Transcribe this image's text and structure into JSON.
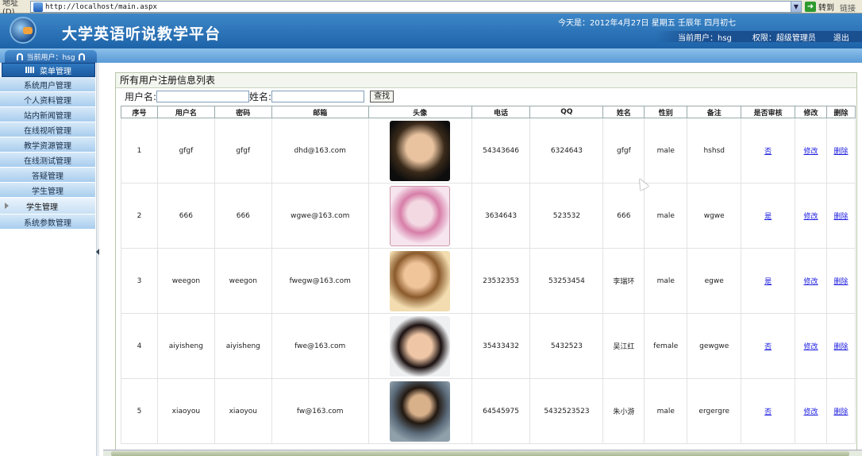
{
  "browser": {
    "address_label": "地址(D)",
    "url": "http://localhost/main.aspx",
    "go_label": "转到",
    "links_label": "链接"
  },
  "header": {
    "site_title": "大学英语听说教学平台",
    "date_text": "今天是：2012年4月27日 星期五  壬辰年  四月初七",
    "current_user_text": "当前用户：hsg",
    "permission_text": "权限：超级管理员",
    "logout_label": "退出"
  },
  "sidebar": {
    "current_user": "当前用户：hsg",
    "menu_title": "菜单管理",
    "items": [
      {
        "label": "系统用户管理"
      },
      {
        "label": "个人资料管理"
      },
      {
        "label": "站内新闻管理"
      },
      {
        "label": "在线视听管理"
      },
      {
        "label": "教学资源管理"
      },
      {
        "label": "在线测试管理"
      },
      {
        "label": "答疑管理"
      },
      {
        "label": "学生管理"
      },
      {
        "label": "学生管理"
      },
      {
        "label": "系统参数管理"
      }
    ]
  },
  "main": {
    "panel_title": "所有用户注册信息列表",
    "search": {
      "username_label": "用户名:",
      "username_value": "",
      "name_label": "姓名:",
      "name_value": "",
      "button_label": "查找"
    },
    "table": {
      "headers": [
        "序号",
        "用户名",
        "密码",
        "邮箱",
        "头像",
        "电话",
        "QQ",
        "姓名",
        "性别",
        "备注",
        "是否审核",
        "修改",
        "删除"
      ],
      "rows": [
        {
          "no": "1",
          "username": "gfgf",
          "password": "gfgf",
          "email": "dhd@163.com",
          "phone": "54343646",
          "qq": "6324643",
          "name": "gfgf",
          "gender": "male",
          "note": "hshsd",
          "audited": "否",
          "edit": "修改",
          "delete": "删除"
        },
        {
          "no": "2",
          "username": "666",
          "password": "666",
          "email": "wgwe@163.com",
          "phone": "3634643",
          "qq": "523532",
          "name": "666",
          "gender": "male",
          "note": "wgwe",
          "audited": "是",
          "edit": "修改",
          "delete": "删除"
        },
        {
          "no": "3",
          "username": "weegon",
          "password": "weegon",
          "email": "fwegw@163.com",
          "phone": "23532353",
          "qq": "53253454",
          "name": "李瑞环",
          "gender": "male",
          "note": "egwe",
          "audited": "是",
          "edit": "修改",
          "delete": "删除"
        },
        {
          "no": "4",
          "username": "aiyisheng",
          "password": "aiyisheng",
          "email": "fwe@163.com",
          "phone": "35433432",
          "qq": "5432523",
          "name": "吴江红",
          "gender": "female",
          "note": "gewgwe",
          "audited": "否",
          "edit": "修改",
          "delete": "删除"
        },
        {
          "no": "5",
          "username": "xiaoyou",
          "password": "xiaoyou",
          "email": "fw@163.com",
          "phone": "64545975",
          "qq": "5432523523",
          "name": "朱小游",
          "gender": "male",
          "note": "ergergre",
          "audited": "否",
          "edit": "修改",
          "delete": "删除"
        }
      ]
    }
  }
}
